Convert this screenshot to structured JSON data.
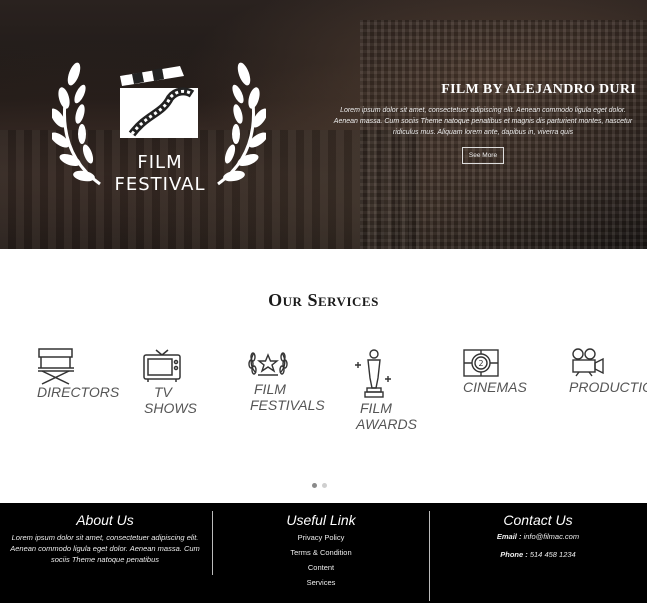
{
  "hero": {
    "logo_line1": "FILM",
    "logo_line2": "FESTIVAL",
    "title": "FILM BY ALEJANDRO DURI",
    "description": "Lorem ipsum dolor sit amet, consectetuer adipiscing elit. Aenean commodo ligula eget dolor. Aenean massa. Cum sociis Theme natoque penatibus et magnis dis parturient montes, nascetur ridiculus mus. Aliquam lorem ante, dapibus in, viverra quis",
    "button_label": "See More"
  },
  "services": {
    "title": "Our Services",
    "items": [
      {
        "line1": "DIRECTORS",
        "line2": "",
        "icon": "directors-chair-icon"
      },
      {
        "line1": "TV",
        "line2": "SHOWS",
        "icon": "tv-icon"
      },
      {
        "line1": "FILM",
        "line2": "FESTIVALS",
        "icon": "laurel-star-icon"
      },
      {
        "line1": "FILM",
        "line2": "AWARDS",
        "icon": "oscar-statue-icon"
      },
      {
        "line1": "CINEMAS",
        "line2": "",
        "icon": "film-countdown-icon"
      },
      {
        "line1": "PRODUCTIC",
        "line2": "",
        "icon": "movie-camera-icon"
      }
    ],
    "carousel_active": 1,
    "carousel_count": 2
  },
  "footer": {
    "about": {
      "title": "About Us",
      "text": "Lorem ipsum dolor sit amet, consectetuer adipiscing elit. Aenean commodo ligula eget dolor. Aenean massa. Cum sociis Theme natoque penatibus"
    },
    "links": {
      "title": "Useful Link",
      "items": [
        "Privacy Policy",
        "Terms & Condition",
        "Content",
        "Services"
      ]
    },
    "contact": {
      "title": "Contact Us",
      "email_label": "Email :",
      "email": "info@filmac.com",
      "phone_label": "Phone :",
      "phone": "514 458 1234"
    }
  },
  "colors": {
    "footer_bg": "#000000",
    "dot_active": "#8a8a8a",
    "dot_inactive": "#cfcfcf"
  }
}
